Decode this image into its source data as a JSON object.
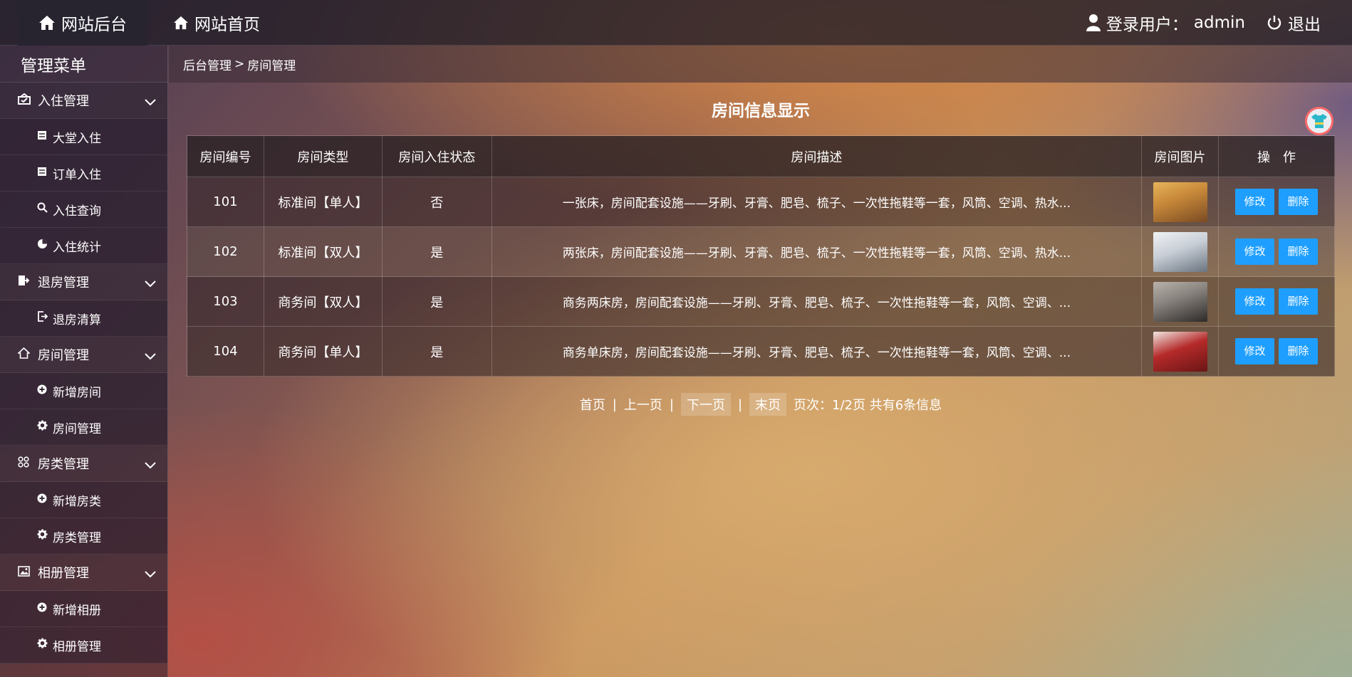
{
  "header": {
    "brand_label": "网站后台",
    "home_label": "网站首页",
    "user_label": "登录用户：",
    "user_name": "admin",
    "logout_label": "退出"
  },
  "sidebar": {
    "title": "管理菜单",
    "groups": [
      {
        "label": "入住管理",
        "icon": "checkin-icon",
        "items": [
          {
            "label": "大堂入住",
            "icon": "doc-icon"
          },
          {
            "label": "订单入住",
            "icon": "doc-icon"
          },
          {
            "label": "入住查询",
            "icon": "search-icon"
          },
          {
            "label": "入住统计",
            "icon": "pie-chart-icon"
          }
        ]
      },
      {
        "label": "退房管理",
        "icon": "checkout-icon",
        "items": [
          {
            "label": "退房清算",
            "icon": "exit-icon"
          }
        ]
      },
      {
        "label": "房间管理",
        "icon": "home-icon",
        "items": [
          {
            "label": "新增房间",
            "icon": "plus-circle-icon"
          },
          {
            "label": "房间管理",
            "icon": "gear-icon"
          }
        ]
      },
      {
        "label": "房类管理",
        "icon": "grid-icon",
        "items": [
          {
            "label": "新增房类",
            "icon": "plus-circle-icon"
          },
          {
            "label": "房类管理",
            "icon": "gear-icon"
          }
        ]
      },
      {
        "label": "相册管理",
        "icon": "image-icon",
        "items": [
          {
            "label": "新增相册",
            "icon": "plus-circle-icon"
          },
          {
            "label": "相册管理",
            "icon": "gear-icon"
          }
        ]
      }
    ]
  },
  "breadcrumb": {
    "root": "后台管理",
    "sep": ">",
    "current": "房间管理"
  },
  "main": {
    "title": "房间信息显示",
    "columns": [
      "房间编号",
      "房间类型",
      "房间入住状态",
      "房间描述",
      "房间图片",
      "操　作"
    ],
    "rows": [
      {
        "no": "101",
        "type": "标准间【单人】",
        "status": "否",
        "desc": "一张床，房间配套设施——牙刷、牙膏、肥皂、梳子、一次性拖鞋等一套，风筒、空调、热水...",
        "thumb_colors": [
          "#c98a3a",
          "#7a4a22"
        ]
      },
      {
        "no": "102",
        "type": "标准间【双人】",
        "status": "是",
        "desc": "两张床，房间配套设施——牙刷、牙膏、肥皂、梳子、一次性拖鞋等一套，风筒、空调、热水...",
        "thumb_colors": [
          "#d8dde2",
          "#6a7480"
        ]
      },
      {
        "no": "103",
        "type": "商务间【双人】",
        "status": "是",
        "desc": "商务两床房，房间配套设施——牙刷、牙膏、肥皂、梳子、一次性拖鞋等一套，风筒、空调、...",
        "thumb_colors": [
          "#8a8580",
          "#2e2a28"
        ]
      },
      {
        "no": "104",
        "type": "商务间【单人】",
        "status": "是",
        "desc": "商务单床房，房间配套设施——牙刷、牙膏、肥皂、梳子、一次性拖鞋等一套，风筒、空调、...",
        "thumb_colors": [
          "#b52a2a",
          "#f0e6e0"
        ]
      }
    ],
    "edit_label": "修改",
    "delete_label": "删除"
  },
  "pager": {
    "first": "首页",
    "sep1": "|",
    "prev": "上一页",
    "sep2": "|",
    "next": "下一页",
    "sep3": "|",
    "last": "末页",
    "info": "页次：1/2页 共有6条信息"
  },
  "colors": {
    "primary_button": "#1e9fff"
  }
}
